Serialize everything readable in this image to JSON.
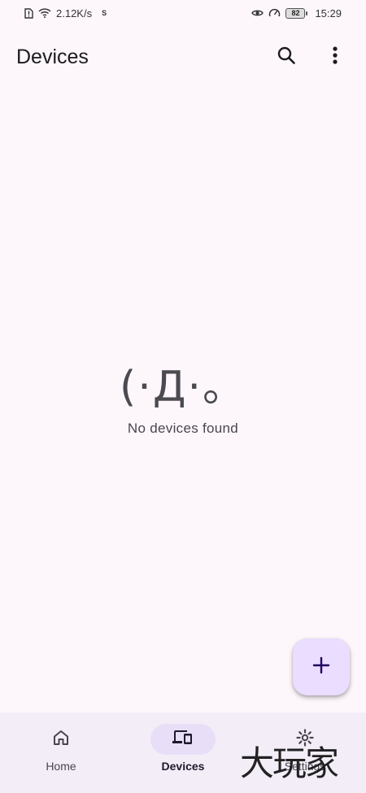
{
  "status_bar": {
    "net_speed": "2.12K/s",
    "carrier_mark": "S",
    "battery": "82",
    "time": "15:29"
  },
  "app_bar": {
    "title": "Devices",
    "icons": [
      "search-icon",
      "more-vert-icon"
    ]
  },
  "empty_state": {
    "kaomoji": "(·Д·。",
    "message": "No devices found"
  },
  "fab": {
    "icon": "add-icon"
  },
  "bottom_nav": {
    "items": [
      {
        "label": "Home",
        "icon": "home-icon"
      },
      {
        "label": "Devices",
        "icon": "devices-icon"
      },
      {
        "label": "Settings",
        "icon": "gear-icon"
      }
    ],
    "active_index": 1
  },
  "watermark": {
    "text": "大玩家"
  },
  "colors": {
    "background": "#fdf7fc",
    "fab": "#eaddff",
    "nav_bg": "#f3edf7",
    "nav_active": "#e8def8"
  }
}
